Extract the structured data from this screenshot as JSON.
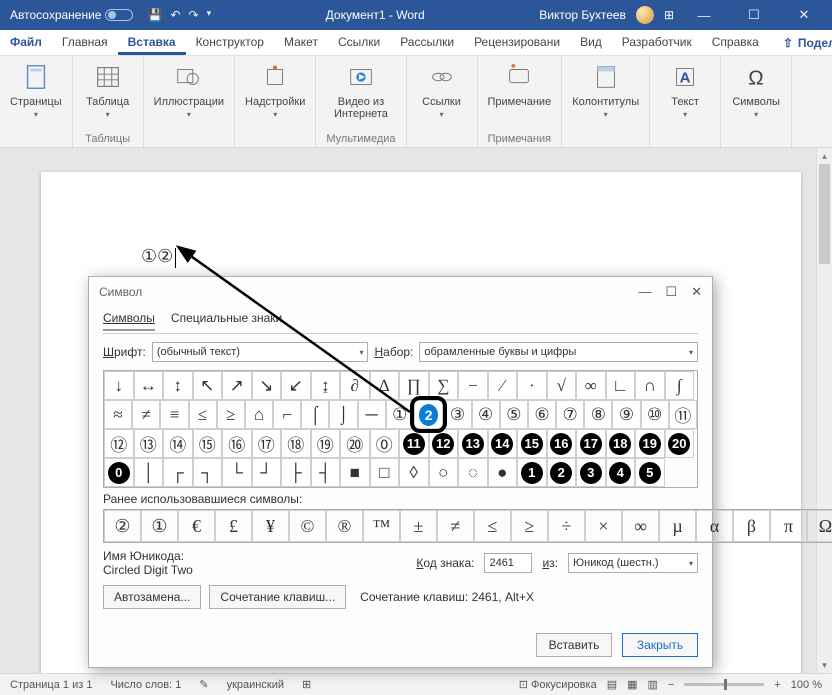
{
  "titlebar": {
    "autosave": "Автосохранение",
    "doc": "Документ1 - Word",
    "user": "Виктор Бухтеев"
  },
  "menu": {
    "file": "Файл",
    "tabs": [
      "Главная",
      "Вставка",
      "Конструктор",
      "Макет",
      "Ссылки",
      "Рассылки",
      "Рецензировани",
      "Вид",
      "Разработчик",
      "Справка"
    ],
    "active_index": 1,
    "share": "Поделиться"
  },
  "ribbon": {
    "groups": [
      {
        "label": "",
        "items": [
          {
            "label": "Страницы"
          }
        ]
      },
      {
        "label": "Таблицы",
        "items": [
          {
            "label": "Таблица"
          }
        ]
      },
      {
        "label": "",
        "items": [
          {
            "label": "Иллюстрации"
          }
        ]
      },
      {
        "label": "",
        "items": [
          {
            "label": "Надстройки"
          }
        ]
      },
      {
        "label": "Мультимедиа",
        "items": [
          {
            "label": "Видео из\nИнтернета"
          }
        ]
      },
      {
        "label": "",
        "items": [
          {
            "label": "Ссылки"
          }
        ]
      },
      {
        "label": "Примечания",
        "items": [
          {
            "label": "Примечание"
          }
        ]
      },
      {
        "label": "",
        "items": [
          {
            "label": "Колонтитулы"
          }
        ]
      },
      {
        "label": "",
        "items": [
          {
            "label": "Текст"
          }
        ]
      },
      {
        "label": "",
        "items": [
          {
            "label": "Символы"
          }
        ]
      }
    ]
  },
  "page": {
    "content": "①②"
  },
  "dialog": {
    "title": "Символ",
    "tabs": {
      "symbols": "Символы",
      "special": "Специальные знаки"
    },
    "font_label": "Шрифт:",
    "font_value": "(обычный текст)",
    "set_label": "Набор:",
    "set_value": "обрамленные буквы и цифры",
    "grid": [
      [
        "↓",
        "↔",
        "↕",
        "↖",
        "↗",
        "↘",
        "↙",
        "↨",
        "∂",
        "∆",
        "∏",
        "∑",
        "−",
        "∕",
        "∙",
        "√",
        "∞",
        "∟",
        "∩",
        "∫"
      ],
      [
        "≈",
        "≠",
        "≡",
        "≤",
        "≥",
        "⌂",
        "⌐",
        "⌠",
        "⌡",
        "─",
        "①",
        "②",
        "③",
        "④",
        "⑤",
        "⑥",
        "⑦",
        "⑧",
        "⑨",
        "⑩",
        "⑪"
      ],
      [
        "⑫",
        "⑬",
        "⑭",
        "⑮",
        "⑯",
        "⑰",
        "⑱",
        "⑲",
        "⑳",
        "⓪",
        "⓫",
        "⓬",
        "⓭",
        "⓮",
        "⓯",
        "⓰",
        "⓱",
        "⓲",
        "⓳",
        "⓴"
      ],
      [
        "⓿",
        "│",
        "┌",
        "┐",
        "└",
        "┘",
        "├",
        "┤",
        "■",
        "□",
        "◊",
        "○",
        "◌",
        "●",
        "❶",
        "❷",
        "❸",
        "❹",
        "❺"
      ]
    ],
    "selected": {
      "row": 1,
      "col": 11
    },
    "recent_label": "Ранее использовавшиеся символы:",
    "recent": [
      "②",
      "①",
      "€",
      "£",
      "¥",
      "©",
      "®",
      "™",
      "±",
      "≠",
      "≤",
      "≥",
      "÷",
      "×",
      "∞",
      "µ",
      "α",
      "β",
      "π",
      "Ω"
    ],
    "unicode_name_label": "Имя Юникода:",
    "unicode_name": "Circled Digit Two",
    "code_label": "Код знака:",
    "code_value": "2461",
    "from_label": "из:",
    "from_value": "Юникод (шестн.)",
    "autocorrect": "Автозамена...",
    "shortcut": "Сочетание клавиш...",
    "shortcut_hint": "Сочетание клавиш: 2461, Alt+X",
    "insert": "Вставить",
    "close": "Закрыть"
  },
  "status": {
    "page": "Страница 1 из 1",
    "words": "Число слов: 1",
    "lang": "украинский",
    "focus": "Фокусировка",
    "zoom": "100 %"
  }
}
